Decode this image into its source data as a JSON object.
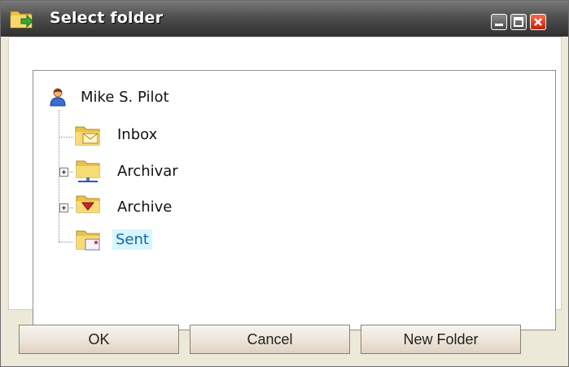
{
  "window": {
    "title": "Select folder",
    "controls": [
      "minimize",
      "maximize",
      "close"
    ]
  },
  "tree": {
    "root": {
      "label": "Mike S. Pilot",
      "icon": "user-icon"
    },
    "children": [
      {
        "label": "Inbox",
        "icon": "inbox-folder-icon",
        "expandable": false,
        "selected": false
      },
      {
        "label": "Archivar",
        "icon": "archive-network-folder-icon",
        "expandable": true,
        "selected": false
      },
      {
        "label": "Archive",
        "icon": "archive-folder-icon",
        "expandable": true,
        "selected": false
      },
      {
        "label": "Sent",
        "icon": "sent-folder-icon",
        "expandable": false,
        "selected": true
      }
    ]
  },
  "buttons": {
    "ok": "OK",
    "cancel": "Cancel",
    "new_folder": "New Folder"
  },
  "colors": {
    "titlebar": "#4f4f4f",
    "selection_bg": "#d6f6fe",
    "selection_text": "#1565a8",
    "window_bg": "#ece9d8"
  }
}
